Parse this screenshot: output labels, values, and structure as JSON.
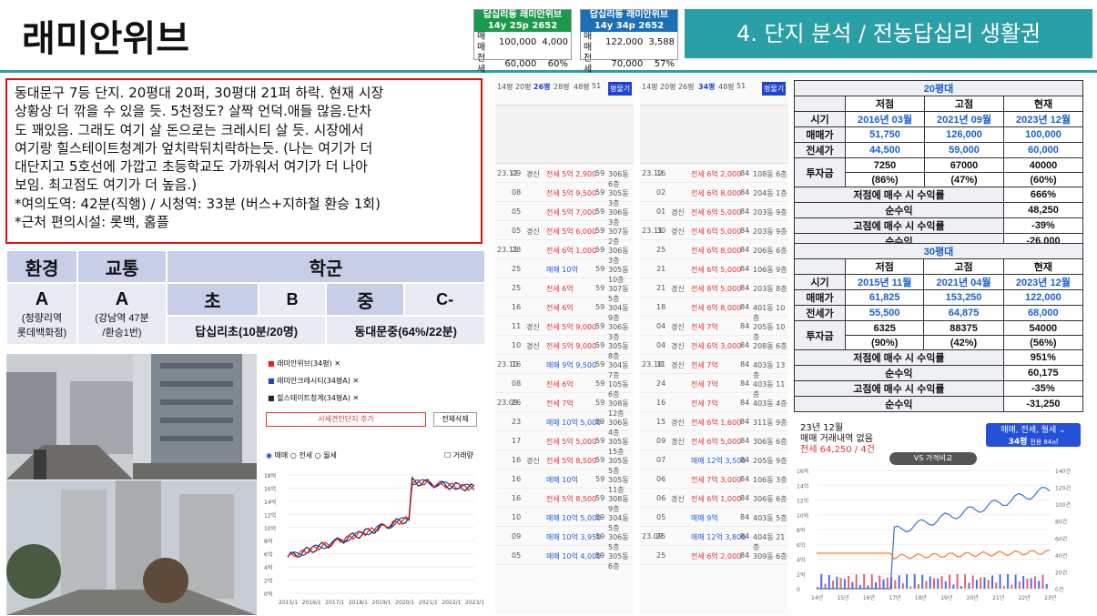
{
  "header": {
    "title": "래미안위브",
    "section_title": "4. 단지 분석 / 전농답십리 생활권"
  },
  "price_boxes": [
    {
      "title": "답십리동 래미안위브",
      "sub": "14y 25p 2652",
      "rows": [
        [
          "매매",
          "100,000",
          "4,000"
        ],
        [
          "전세",
          "60,000",
          "60%"
        ]
      ]
    },
    {
      "title": "답십리동 래미안위브",
      "sub": "14y 34p 2652",
      "rows": [
        [
          "매매",
          "122,000",
          "3,588"
        ],
        [
          "전세",
          "70,000",
          "57%"
        ]
      ]
    }
  ],
  "note": {
    "lines": [
      "동대문구 7등 단지. 20평대 20퍼, 30평대 21퍼 하락. 현재 시장",
      "상황상 더 깎을 수 있을 듯. 5천정도? 살짝 언덕.애들 많음.단차",
      "도 꽤있음. 그래도 여기 살 돈으로는 크레시티 살 듯. 시장에서",
      "여기랑 힐스테이트청계가 엎치락뒤치락하는듯. (나는 여기가 더",
      "대단지고 5호선에 가깝고 초등학교도 가까워서 여기가 더 나아",
      "보임. 최고점도 여기가 더 높음.)",
      "*여의도역: 42분(직행) / 시청역: 33분 (버스+지하철 환승 1회)",
      "*근처 편의시설: 롯백, 홈플"
    ]
  },
  "grades": {
    "h_env": "환경",
    "h_trans": "교통",
    "h_school": "학군",
    "env_grade": "A",
    "env_desc": "(청량리역\n롯데백화점)",
    "trans_grade": "A",
    "trans_desc": "(강남역 47분\n/환승1번)",
    "elem_label": "초",
    "elem_grade": "B",
    "mid_label": "중",
    "mid_grade": "C-",
    "elem_school": "답십리초(10분/20명)",
    "mid_school": "동대문중(64%/22분)"
  },
  "chart1": {
    "legend": [
      "래미안위브(34평)",
      "래미안크레시티(34평A)",
      "힐스테이트청계(34평A)"
    ],
    "add_btn": "시세견인단지 추가",
    "clear_btn": "전체삭제",
    "radios": [
      "매매",
      "전세",
      "월세"
    ],
    "check": "거래량",
    "y_ticks": [
      "18억",
      "16억",
      "14억",
      "12억",
      "10억",
      "8억",
      "6억",
      "4억",
      "2억",
      "0억"
    ],
    "x_ticks": [
      "2015/1",
      "2016/1",
      "2017/1",
      "2018/1",
      "2019/1",
      "2020/1",
      "2021/1",
      "2022/1",
      "2023/1"
    ]
  },
  "listings": {
    "left": {
      "tabs": [
        "14평",
        "20평",
        "26평",
        "28평",
        "48평",
        "51"
      ],
      "btn": "평물기",
      "rows": [
        [
          "23.12",
          "09",
          "경신",
          "전세 5억 2,900",
          "59",
          "306동 6층"
        ],
        [
          "",
          "08",
          "",
          "전세 5억 9,500",
          "59",
          "305동 3층"
        ],
        [
          "",
          "05",
          "",
          "전세 5억 7,000",
          "59",
          "306동 3층"
        ],
        [
          "",
          "05",
          "경신",
          "전세 5억 6,000",
          "59",
          "307동 2층"
        ],
        [
          "23.11",
          "28",
          "",
          "전세 6억 1,000",
          "59",
          "306동 3층"
        ],
        [
          "",
          "25",
          "",
          "매매 10억",
          "59",
          "305동 10층"
        ],
        [
          "",
          "25",
          "",
          "전세 6억",
          "59",
          "307동 5층"
        ],
        [
          "",
          "16",
          "",
          "전세 6억",
          "59",
          "304동 9층"
        ],
        [
          "",
          "11",
          "경신",
          "전세 5억 9,000",
          "59",
          "306동 3층"
        ],
        [
          "",
          "10",
          "경신",
          "전세 5억 9,000",
          "59",
          "305동 8층"
        ],
        [
          "23.10",
          "16",
          "",
          "매매 9억 9,500",
          "59",
          "304동 7층"
        ],
        [
          "",
          "08",
          "",
          "전세 6억",
          "59",
          "105동 6층"
        ],
        [
          "23.09",
          "26",
          "",
          "전세 7억",
          "59",
          "308동 12층"
        ],
        [
          "",
          "23",
          "",
          "매매 10억 5,000",
          "59",
          "306동 4층"
        ],
        [
          "",
          "17",
          "",
          "전세 5억 5,000",
          "59",
          "305동 15층"
        ],
        [
          "",
          "16",
          "경신",
          "전세 5억 8,500",
          "59",
          "305동 5층"
        ],
        [
          "",
          "16",
          "",
          "매매 10억",
          "59",
          "305동 11층"
        ],
        [
          "",
          "16",
          "",
          "전세 5억 8,500",
          "59",
          "308동 9층"
        ],
        [
          "",
          "10",
          "",
          "매매 10억 5,000",
          "59",
          "304동 5층"
        ],
        [
          "",
          "09",
          "",
          "매매 10억 3,950",
          "59",
          "306동 5층"
        ],
        [
          "",
          "05",
          "",
          "매매 10억 4,000",
          "59",
          "305동 6층"
        ]
      ]
    },
    "right": {
      "tabs": [
        "14평",
        "20평",
        "26평",
        "34평",
        "48평",
        "51"
      ],
      "btn": "평물기",
      "rows": [
        [
          "23.12",
          "16",
          "",
          "전세 6억 2,000",
          "84",
          "108동 6층"
        ],
        [
          "",
          "02",
          "",
          "전세 6억 8,000",
          "84",
          "204동 1층"
        ],
        [
          "",
          "01",
          "경신",
          "전세 6억 5,000",
          "84",
          "203동 9층"
        ],
        [
          "23.11",
          "30",
          "경신",
          "전세 6억 5,000",
          "84",
          "203동 9층"
        ],
        [
          "",
          "25",
          "",
          "전세 6억 8,000",
          "84",
          "206동 6층"
        ],
        [
          "",
          "21",
          "",
          "전세 6억 5,000",
          "84",
          "106동 9층"
        ],
        [
          "",
          "21",
          "경신",
          "전세 8억 5,000",
          "84",
          "203동 8층"
        ],
        [
          "",
          "18",
          "",
          "전세 6억 8,000",
          "84",
          "401동 10층"
        ],
        [
          "",
          "04",
          "경신",
          "전세 7억",
          "84",
          "205동 10층"
        ],
        [
          "",
          "04",
          "경신",
          "전세 6억 3,000",
          "84",
          "208동 6층"
        ],
        [
          "23.10",
          "31",
          "경신",
          "전세 7억",
          "84",
          "403동 13층"
        ],
        [
          "",
          "24",
          "",
          "전세 7억",
          "84",
          "403동 11층"
        ],
        [
          "",
          "16",
          "",
          "전세 7억",
          "84",
          "403동 4층"
        ],
        [
          "",
          "15",
          "경신",
          "전세 6억 1,600",
          "84",
          "311동 9층"
        ],
        [
          "",
          "09",
          "경신",
          "전세 6억 5,000",
          "84",
          "306동 6층"
        ],
        [
          "",
          "07",
          "",
          "매매 12억 3,500",
          "84",
          "205동 9층"
        ],
        [
          "",
          "06",
          "",
          "전세 7억 3,000",
          "84",
          "106동 3층"
        ],
        [
          "",
          "06",
          "경신",
          "전세 6억 1,000",
          "84",
          "306동 6층"
        ],
        [
          "",
          "05",
          "",
          "매매 9억",
          "84",
          "403동 5층"
        ],
        [
          "23.09",
          "25",
          "",
          "매매 12억 3,800",
          "84",
          "404동 21층"
        ],
        [
          "",
          "25",
          "",
          "전세 6억 2,000",
          "84",
          "309동 6층"
        ]
      ]
    }
  },
  "t20": {
    "title": "20평대",
    "cols": [
      "저점",
      "고점",
      "현재"
    ],
    "era": [
      "시기",
      "2016년 03월",
      "2021년 09월",
      "2023년 12월"
    ],
    "sale": [
      "매매가",
      "51,750",
      "126,000",
      "100,000"
    ],
    "jeonse": [
      "전세가",
      "44,500",
      "59,000",
      "60,000"
    ],
    "invest_label": "투자금",
    "invest": [
      "7250",
      "67000",
      "40000"
    ],
    "invest_pct": [
      "(86%)",
      "(47%)",
      "(60%)"
    ],
    "r1": [
      "저점에 매수 시 수익률",
      "666%"
    ],
    "r2": [
      "순수익",
      "48,250"
    ],
    "r3": [
      "고점에 매수 시 수익률",
      "-39%"
    ],
    "r4": [
      "순수익",
      "-26,000"
    ]
  },
  "t30": {
    "title": "30평대",
    "cols": [
      "저점",
      "고점",
      "현재"
    ],
    "era": [
      "시기",
      "2015년 11월",
      "2021년 04월",
      "2023년 12월"
    ],
    "sale": [
      "매매가",
      "61,825",
      "153,250",
      "122,000"
    ],
    "jeonse": [
      "전세가",
      "55,500",
      "64,875",
      "68,000"
    ],
    "invest_label": "투자금",
    "invest": [
      "6325",
      "88375",
      "54000"
    ],
    "invest_pct": [
      "(90%)",
      "(42%)",
      "(56%)"
    ],
    "r1": [
      "저점에 매수 시 수익률",
      "951%"
    ],
    "r2": [
      "순수익",
      "60,175"
    ],
    "r3": [
      "고점에 매수 시 수익률",
      "-35%"
    ],
    "r4": [
      "순수익",
      "-31,250"
    ]
  },
  "chart2": {
    "l1": "23년 12월",
    "l2": "매매 거래내역 없음",
    "l3": "전세 64,250 / 4건",
    "badge1": "매매, 전세, 월세",
    "badge2": "34평",
    "badge3": "전용 84㎡",
    "vs": "VS 가격비교",
    "y_left": [
      "16억",
      "14억",
      "12억",
      "10억",
      "8억",
      "6억",
      "4억",
      "2억",
      "0"
    ],
    "y_right": [
      "140건",
      "120건",
      "100건",
      "80건",
      "60건",
      "40건",
      "20건",
      "0건"
    ],
    "x": [
      "14년",
      "15년",
      "16년",
      "17년",
      "18년",
      "19년",
      "20년",
      "21년",
      "22년",
      "23년"
    ]
  },
  "colors": {
    "accent": "#2a9fa5",
    "note_border": "#e01010",
    "grade_header": "#c8cde8"
  }
}
